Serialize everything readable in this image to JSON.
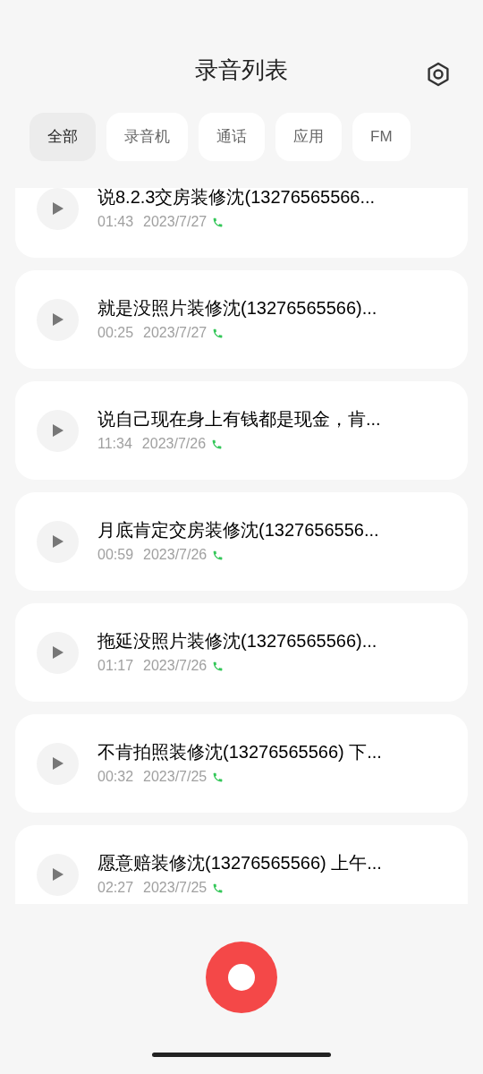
{
  "header": {
    "title": "录音列表"
  },
  "tabs": [
    {
      "label": "全部",
      "selected": true
    },
    {
      "label": "录音机",
      "selected": false
    },
    {
      "label": "通话",
      "selected": false
    },
    {
      "label": "应用",
      "selected": false
    },
    {
      "label": "FM",
      "selected": false
    }
  ],
  "recordings": [
    {
      "title": "说8.2.3交房装修沈(13276565566...",
      "duration": "01:43",
      "date": "2023/7/27",
      "kind": "call"
    },
    {
      "title": "就是没照片装修沈(13276565566)...",
      "duration": "00:25",
      "date": "2023/7/27",
      "kind": "call"
    },
    {
      "title": "说自己现在身上有钱都是现金，肯...",
      "duration": "11:34",
      "date": "2023/7/26",
      "kind": "call"
    },
    {
      "title": "月底肯定交房装修沈(1327656556...",
      "duration": "00:59",
      "date": "2023/7/26",
      "kind": "call"
    },
    {
      "title": "拖延没照片装修沈(13276565566)...",
      "duration": "01:17",
      "date": "2023/7/26",
      "kind": "call"
    },
    {
      "title": "不肯拍照装修沈(13276565566) 下...",
      "duration": "00:32",
      "date": "2023/7/25",
      "kind": "call"
    },
    {
      "title": "愿意赔装修沈(13276565566) 上午...",
      "duration": "02:27",
      "date": "2023/7/25",
      "kind": "call"
    }
  ]
}
